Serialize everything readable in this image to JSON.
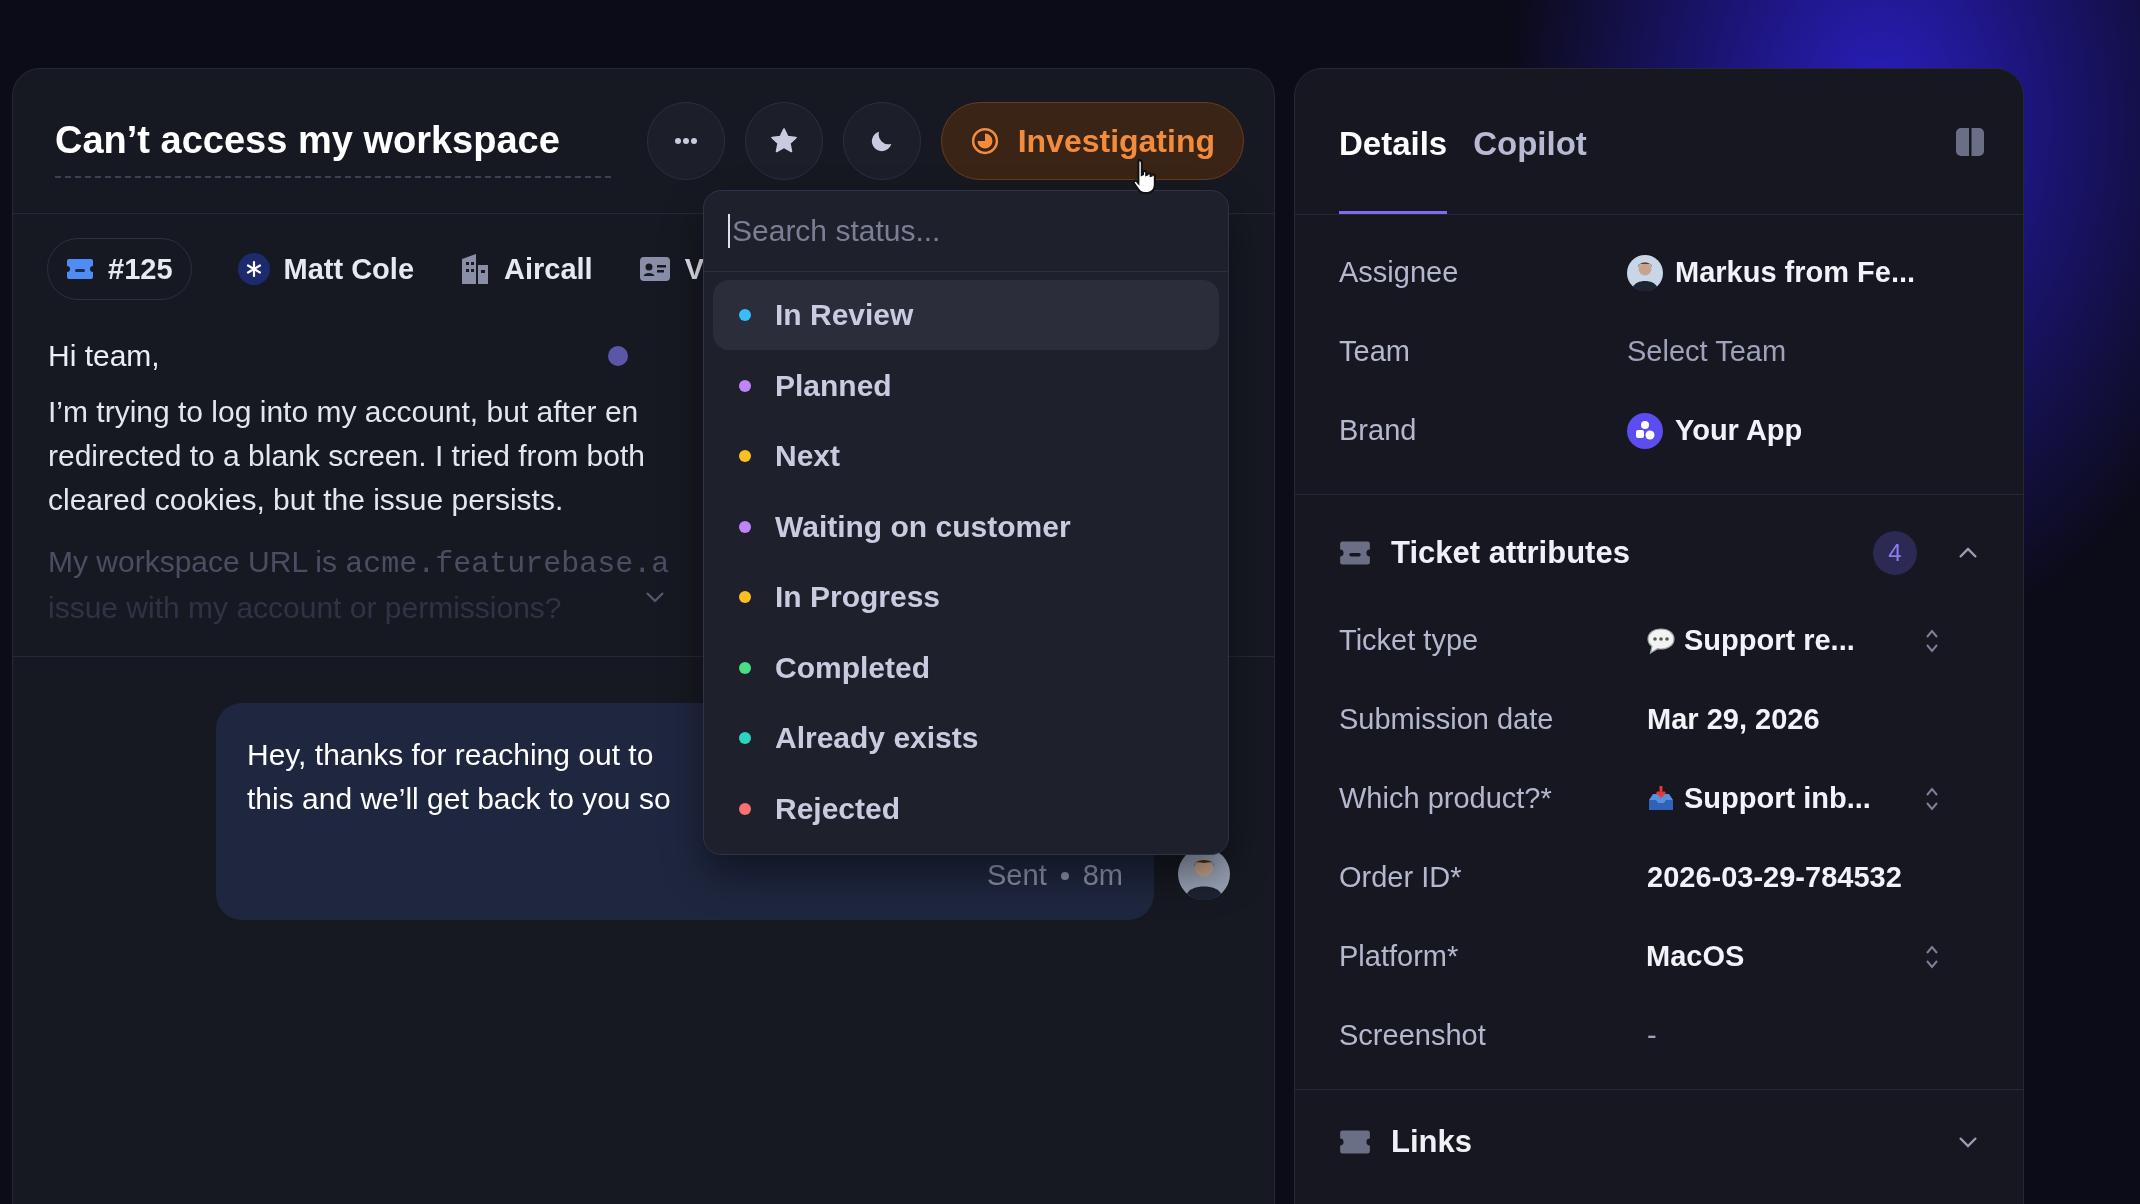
{
  "ticket": {
    "title": "Can’t access my workspace",
    "status": "Investigating"
  },
  "status_menu": {
    "placeholder": "Search status...",
    "items": [
      {
        "label": "In Review",
        "color": "#38bdf8",
        "selected": true
      },
      {
        "label": "Planned",
        "color": "#c084fc",
        "selected": false
      },
      {
        "label": "Next",
        "color": "#fbbf24",
        "selected": false
      },
      {
        "label": "Waiting on customer",
        "color": "#c084fc",
        "selected": false
      },
      {
        "label": "In Progress",
        "color": "#fbbf24",
        "selected": false
      },
      {
        "label": "Completed",
        "color": "#4ade80",
        "selected": false
      },
      {
        "label": "Already exists",
        "color": "#2dd4bf",
        "selected": false
      },
      {
        "label": "Rejected",
        "color": "#f87171",
        "selected": false
      }
    ]
  },
  "chips": [
    {
      "kind": "ticket",
      "label": "#125"
    },
    {
      "kind": "person",
      "label": "Matt Cole"
    },
    {
      "kind": "company",
      "label": "Aircall"
    },
    {
      "kind": "contact",
      "label": "V"
    }
  ],
  "message": {
    "greeting": "Hi team,",
    "lines": [
      {
        "text": "I’m trying to log into my account, but after en",
        "faded": false
      },
      {
        "text": "redirected to a blank screen. I tried from both",
        "faded": false
      },
      {
        "text": "cleared cookies, but the issue persists.",
        "faded": false
      },
      {
        "text": "My workspace URL is ",
        "code": "acme.featurebase.a",
        "faded": true
      },
      {
        "text": "issue with my account or permissions?",
        "faded": true
      }
    ]
  },
  "reply": {
    "lines": [
      "Hey, thanks for reaching out to",
      "this and we’ll get back to you so"
    ],
    "status": "Sent",
    "time": "8m"
  },
  "details": {
    "tabs": [
      {
        "label": "Details",
        "selected": true
      },
      {
        "label": "Copilot",
        "selected": false
      }
    ],
    "fields": [
      {
        "label": "Assignee",
        "value": "Markus from Fe...",
        "kind": "person"
      },
      {
        "label": "Team",
        "value": "Select Team",
        "kind": "placeholder"
      },
      {
        "label": "Brand",
        "value": "Your App",
        "kind": "brand"
      }
    ]
  },
  "ticket_attributes": {
    "title": "Ticket attributes",
    "count": "4",
    "expanded": true,
    "fields": [
      {
        "label": "Ticket type",
        "value": "Support re...",
        "kind": "type_select"
      },
      {
        "label": "Submission date",
        "value": "Mar 29, 2026",
        "kind": "text"
      },
      {
        "label": "Which product?*",
        "value": "Support inb...",
        "kind": "product_select"
      },
      {
        "label": "Order ID*",
        "value": "2026-03-29-784532",
        "kind": "text"
      },
      {
        "label": "Platform*",
        "value": "MacOS",
        "kind": "select"
      },
      {
        "label": "Screenshot",
        "value": "-",
        "kind": "empty"
      }
    ]
  },
  "links": {
    "title": "Links",
    "expanded": false
  }
}
